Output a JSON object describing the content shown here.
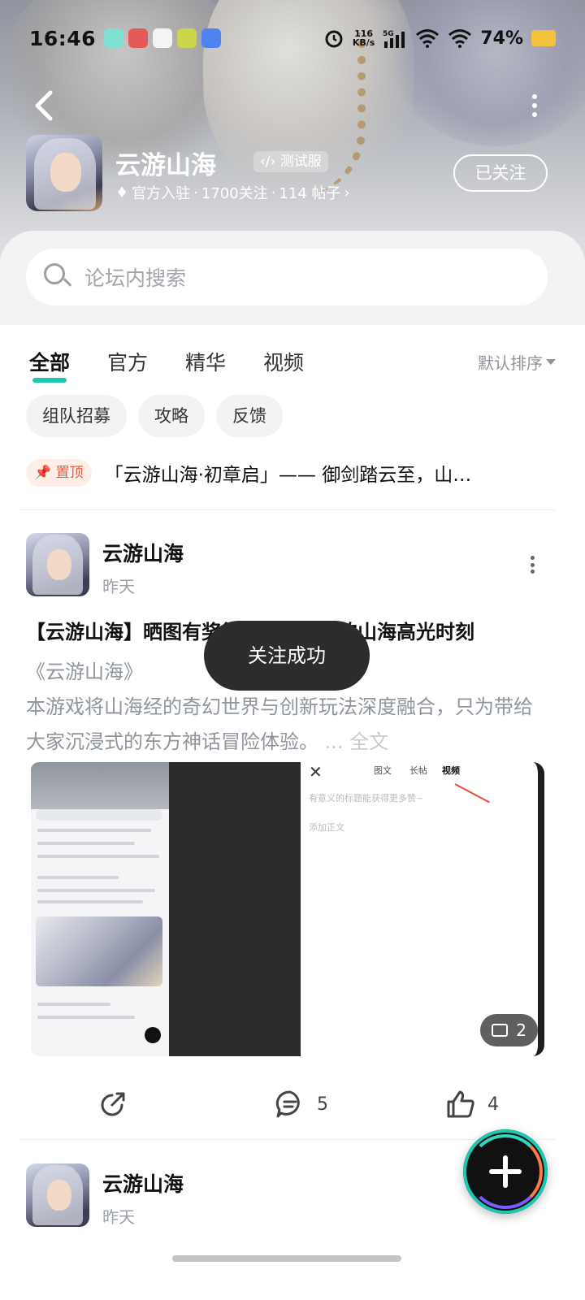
{
  "status_bar": {
    "time": "16:46",
    "net_speed_value": "116",
    "net_speed_unit": "KB/s",
    "network_type": "5G",
    "battery_percent": "74%",
    "icons": [
      "alarm-icon",
      "signal-icon",
      "wifi-icon",
      "wifi-icon",
      "battery-icon"
    ],
    "battery_color": "#f4c13a"
  },
  "header": {
    "back_icon": "chevron-left-icon",
    "more_icon": "more-vertical-icon",
    "forum_name": "云游山海",
    "badge": "测试服",
    "official_label": "官方入驻",
    "followers": "1700关注",
    "posts": "114 帖子",
    "separator": "·",
    "follow_button": "已关注"
  },
  "search": {
    "placeholder": "论坛内搜索"
  },
  "tabs": [
    {
      "label": "全部",
      "active": true
    },
    {
      "label": "官方",
      "active": false
    },
    {
      "label": "精华",
      "active": false
    },
    {
      "label": "视频",
      "active": false
    }
  ],
  "sort_label": "默认排序",
  "chips": [
    "组队招募",
    "攻略",
    "反馈"
  ],
  "pinned": {
    "badge": "置顶",
    "title": "「云游山海·初章启」—— 御剑踏云至，山…"
  },
  "posts": [
    {
      "author": "云游山海",
      "time": "昨天",
      "title": "【云游山海】晒图有奖征集，分享你的山海高光时刻",
      "body_line1": "《云游山海》",
      "body_line2": "本游戏将山海经的奇幻世界与创新玩法深度融合，只为带给大家沉浸式的东方神话冒险体验。",
      "ellipsis": "...",
      "fulltext_link": "全文",
      "image_count": "2",
      "screenshot_tabs": [
        "图文",
        "长帖",
        "视频"
      ],
      "screenshot_title_placeholder": "有意义的标题能获得更多赞~",
      "screenshot_body_placeholder": "添加正文",
      "shares": "",
      "comments": "5",
      "likes": "4"
    },
    {
      "author": "云游山海",
      "time": "昨天"
    }
  ],
  "toast": "关注成功",
  "accent_color": "#1ec7b0"
}
